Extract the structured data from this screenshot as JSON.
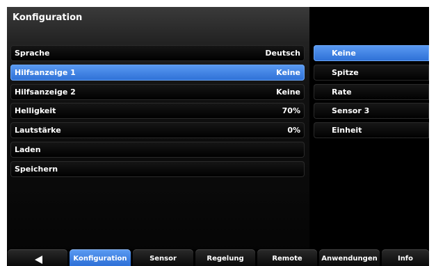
{
  "panel": {
    "title": "Konfiguration"
  },
  "settings": [
    {
      "label": "Sprache",
      "value": "Deutsch"
    },
    {
      "label": "Hilfsanzeige 1",
      "value": "Keine"
    },
    {
      "label": "Hilfsanzeige 2",
      "value": "Keine"
    },
    {
      "label": "Helligkeit",
      "value": "70%"
    },
    {
      "label": "Lautstärke",
      "value": "0%"
    },
    {
      "label": "Laden",
      "value": ""
    },
    {
      "label": "Speichern",
      "value": ""
    }
  ],
  "options": [
    {
      "label": "Keine"
    },
    {
      "label": "Spitze"
    },
    {
      "label": "Rate"
    },
    {
      "label": "Sensor 3"
    },
    {
      "label": "Einheit"
    }
  ],
  "tabs": [
    {
      "label": ""
    },
    {
      "label": "Konfiguration"
    },
    {
      "label": "Sensor"
    },
    {
      "label": "Regelung"
    },
    {
      "label": "Remote"
    },
    {
      "label": "Anwendungen"
    },
    {
      "label": "Info"
    }
  ],
  "colors": {
    "accent": "#3d82e6",
    "background": "#000000"
  },
  "icons": {
    "back": "back-arrow-icon"
  }
}
